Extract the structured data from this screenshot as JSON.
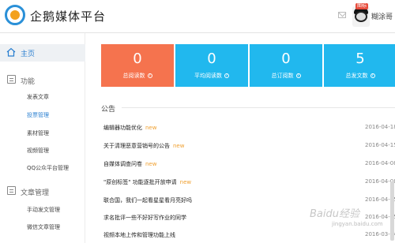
{
  "header": {
    "brand": "企鹅媒体平台",
    "badge": "图标",
    "username": "糊涂哥"
  },
  "sidebar": {
    "home": "主页",
    "function_section": "功能",
    "function_items": [
      "发表文章",
      "投票管理",
      "素材管理",
      "视频管理",
      "QQ公众平台管理"
    ],
    "article_section": "文章管理",
    "article_items": [
      "手动发文管理",
      "微信文章管理"
    ]
  },
  "stats": [
    {
      "value": "0",
      "label": "总阅读数",
      "color": "#f5734e"
    },
    {
      "value": "0",
      "label": "平均阅读数",
      "color": "#21b8ee"
    },
    {
      "value": "0",
      "label": "总订阅数",
      "color": "#21b8ee"
    },
    {
      "value": "5",
      "label": "总发文数",
      "color": "#21b8ee"
    }
  ],
  "announcements": {
    "title": "公告",
    "items": [
      {
        "text": "编辑器功能优化",
        "new": "new",
        "date": "2016-04-18"
      },
      {
        "text": "关于清理恶意营销号的公告",
        "new": "new",
        "date": "2016-04-15"
      },
      {
        "text": "自媒体调查问卷",
        "new": "new",
        "date": "2016-04-08"
      },
      {
        "text": "\"原创标签\" 功能逐批开放申请",
        "new": "new",
        "date": "2016-04-08"
      },
      {
        "text": "联合国，我们一起看星星看月亮好吗",
        "new": "",
        "date": "2016-04-05"
      },
      {
        "text": "求名批评一些不好好写作业的同学",
        "new": "",
        "date": "2016-04-05"
      },
      {
        "text": "视频本地上传和管理功能上线",
        "new": "",
        "date": "2016-03-24"
      }
    ]
  },
  "watermark": {
    "main": "Baidu经验",
    "sub": "jingyan.baidu.com"
  },
  "icons": {
    "home": "home-icon",
    "function": "function-icon",
    "article": "article-icon",
    "mail": "mail-icon",
    "help": "help-icon"
  }
}
